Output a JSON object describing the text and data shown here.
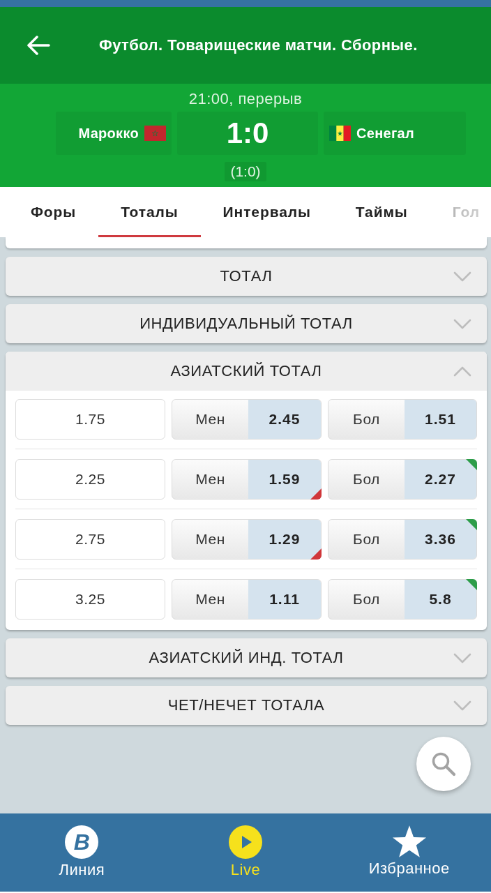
{
  "header": {
    "title": "Футбол. Товарищеские матчи. Сборные."
  },
  "match": {
    "status": "21:00, перерыв",
    "home": "Марокко",
    "score": "1:0",
    "away": "Сенегал",
    "half_score": "(1:0)"
  },
  "tabs": [
    {
      "label": "Форы",
      "selected": false
    },
    {
      "label": "Тоталы",
      "selected": true
    },
    {
      "label": "Интервалы",
      "selected": false
    },
    {
      "label": "Таймы",
      "selected": false
    },
    {
      "label": "Гол",
      "selected": false
    }
  ],
  "markets": [
    {
      "title": "ТОТАЛ",
      "expanded": false
    },
    {
      "title": "ИНДИВИДУАЛЬНЫЙ ТОТАЛ",
      "expanded": false
    },
    {
      "title": "АЗИАТСКИЙ ТОТАЛ",
      "expanded": true,
      "rows": [
        {
          "total": "1.75",
          "under": {
            "label": "Мен",
            "odds": "2.45",
            "rising": false,
            "falling": false
          },
          "over": {
            "label": "Бол",
            "odds": "1.51",
            "rising": false,
            "falling": false
          }
        },
        {
          "total": "2.25",
          "under": {
            "label": "Мен",
            "odds": "1.59",
            "rising": false,
            "falling": true
          },
          "over": {
            "label": "Бол",
            "odds": "2.27",
            "rising": true,
            "falling": false
          }
        },
        {
          "total": "2.75",
          "under": {
            "label": "Мен",
            "odds": "1.29",
            "rising": false,
            "falling": true
          },
          "over": {
            "label": "Бол",
            "odds": "3.36",
            "rising": true,
            "falling": false
          }
        },
        {
          "total": "3.25",
          "under": {
            "label": "Мен",
            "odds": "1.11",
            "rising": false,
            "falling": false
          },
          "over": {
            "label": "Бол",
            "odds": "5.8",
            "rising": true,
            "falling": false
          }
        }
      ]
    },
    {
      "title": "АЗИАТСКИЙ ИНД. ТОТАЛ",
      "expanded": false
    },
    {
      "title": "ЧЕТ/НЕЧЕТ ТОТАЛА",
      "expanded": false
    }
  ],
  "nav": [
    {
      "kind": "logo",
      "icon_text": "B",
      "label": "Линия",
      "selected": false
    },
    {
      "kind": "play",
      "label": "Live",
      "selected": true
    },
    {
      "kind": "star",
      "label": "Избранное",
      "selected": false
    }
  ]
}
